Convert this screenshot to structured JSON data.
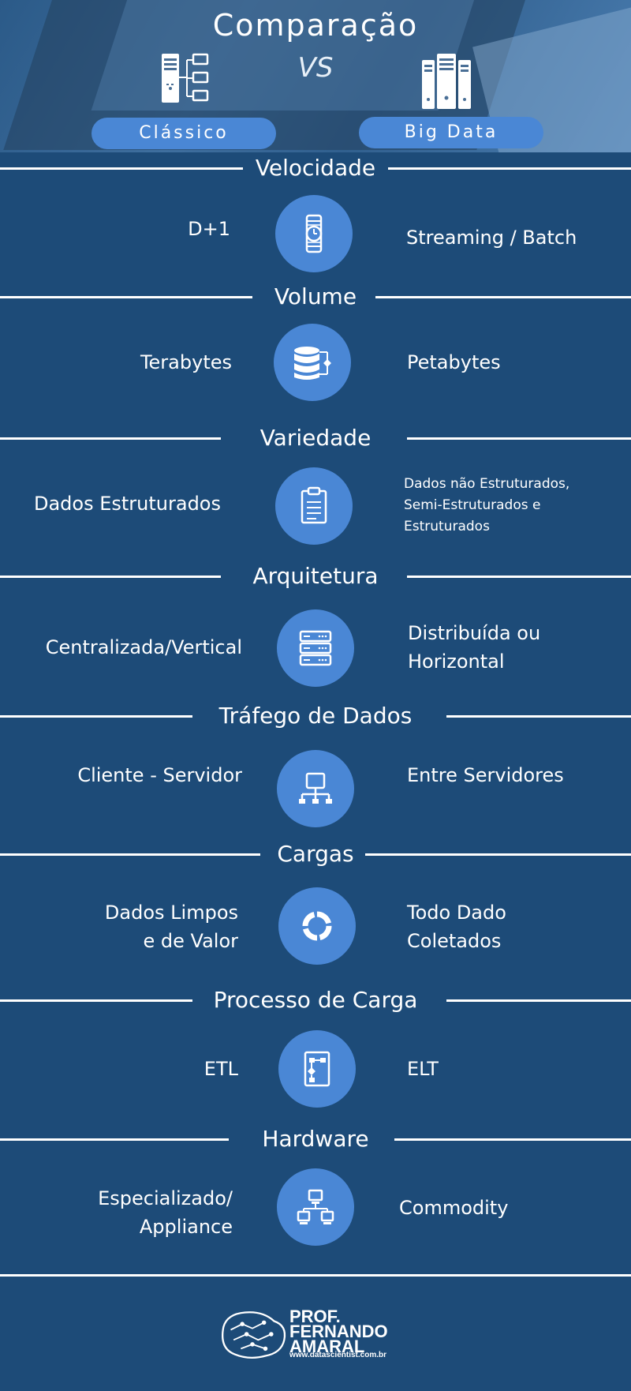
{
  "header": {
    "title": "Comparação",
    "vs": "VS",
    "left_label": "Clássico",
    "right_label": "Big Data"
  },
  "sections": [
    {
      "title": "Velocidade",
      "left": "D+1",
      "right": "Streaming / Batch",
      "icon": "watch-icon"
    },
    {
      "title": "Volume",
      "left": "Terabytes",
      "right": "Petabytes",
      "icon": "database-icon"
    },
    {
      "title": "Variedade",
      "left": "Dados Estruturados",
      "right_lines": [
        "Dados não Estruturados,",
        "Semi-Estruturados e",
        "Estruturados"
      ],
      "icon": "clipboard-icon"
    },
    {
      "title": "Arquitetura",
      "left": "Centralizada/Vertical",
      "right_lines": [
        "Distribuída ou",
        "Horizontal"
      ],
      "icon": "server-stack-icon"
    },
    {
      "title": "Tráfego de Dados",
      "left": "Cliente - Servidor",
      "right": "Entre Servidores",
      "icon": "network-icon"
    },
    {
      "title": "Cargas",
      "left_lines": [
        "Dados Limpos",
        "e de Valor"
      ],
      "right_lines": [
        "Todo Dado",
        "Coletados"
      ],
      "icon": "ring-icon"
    },
    {
      "title": "Processo de Carga",
      "left": "ETL",
      "right": "ELT",
      "icon": "flowchart-icon"
    },
    {
      "title": "Hardware",
      "left_lines": [
        "Especializado/",
        "Appliance"
      ],
      "right": "Commodity",
      "icon": "computers-icon"
    }
  ],
  "footer": {
    "logo_lines": [
      "PROF.",
      "FERNANDO",
      "AMARAL"
    ],
    "url": "www.datascientist.com.br"
  }
}
